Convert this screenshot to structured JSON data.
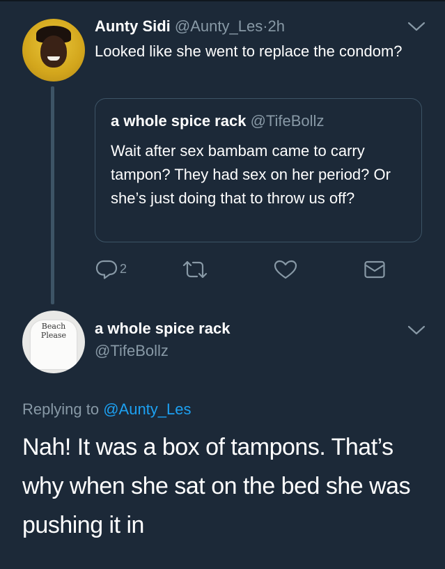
{
  "tweet1": {
    "name": "Aunty Sidi",
    "handle": "@Aunty_Les",
    "separator": "·",
    "time": "2h",
    "text": "Looked like she went to replace the condom?",
    "quote": {
      "name": "a whole spice rack",
      "handle": "@TifeBollz",
      "text": "Wait after sex bambam came to carry tampon? They had sex on her period? Or she’s just doing that to throw us off?"
    },
    "actions": {
      "reply_icon": "reply-icon",
      "reply_count": "2",
      "retweet_icon": "retweet-icon",
      "like_icon": "heart-icon",
      "dm_icon": "envelope-icon"
    }
  },
  "tweet2": {
    "name": "a whole spice rack",
    "handle": "@TifeBollz",
    "avatar_shirt_text": "Beach Please",
    "replying_label": "Replying to",
    "replying_to": "@Aunty_Les",
    "text": "Nah! It was a box of tampons. That’s why when she sat on the bed she was pushing it in"
  },
  "colors": {
    "background": "#1c2938",
    "secondary_text": "#8899a6",
    "link": "#1da1f2",
    "border": "#3d5466"
  }
}
